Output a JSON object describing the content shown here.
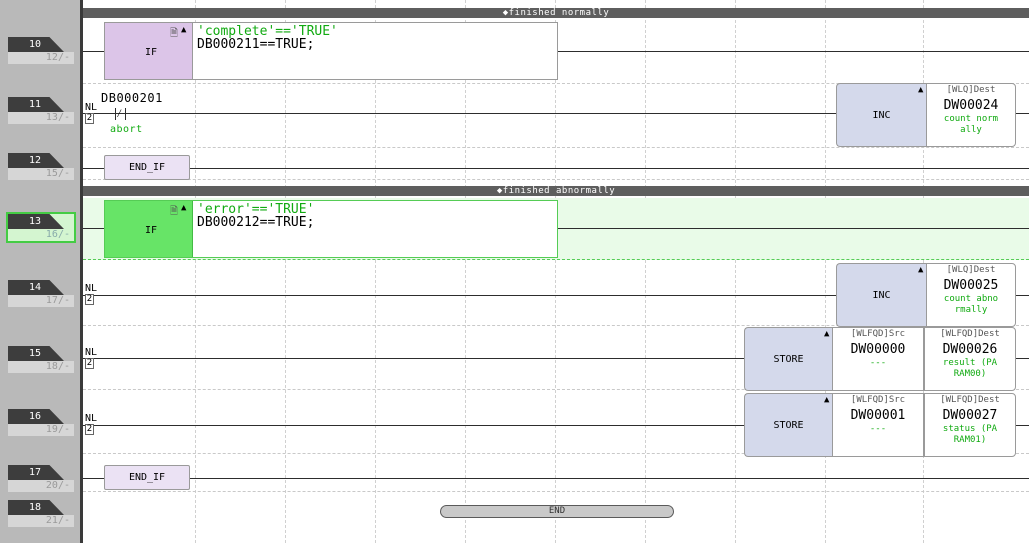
{
  "sections": {
    "normal_label": "◆finished normally",
    "abnormal_label": "◆finished abnormally"
  },
  "lines": [
    {
      "n": "10",
      "sub": "12/-"
    },
    {
      "n": "11",
      "sub": "13/-"
    },
    {
      "n": "12",
      "sub": "15/-"
    },
    {
      "n": "13",
      "sub": "16/-"
    },
    {
      "n": "14",
      "sub": "17/-"
    },
    {
      "n": "15",
      "sub": "18/-"
    },
    {
      "n": "16",
      "sub": "19/-"
    },
    {
      "n": "17",
      "sub": "20/-"
    },
    {
      "n": "18",
      "sub": "21/-"
    }
  ],
  "if1": {
    "keyword": "IF",
    "doc_icon": "document-icon",
    "expr1": "'complete'=='TRUE'",
    "expr2": "DB000211==TRUE;"
  },
  "rung11": {
    "nl": "NL",
    "nl_num": "2",
    "contact_addr": "DB000201",
    "contact_comment": "abort",
    "fb_name": "INC",
    "dest_header": "[WLQ]Dest",
    "dest_operand": "DW00024",
    "dest_comment": "count norm\nally"
  },
  "endif1": {
    "label": "END_IF"
  },
  "if2": {
    "keyword": "IF",
    "doc_icon": "document-icon",
    "expr1": "'error'=='TRUE'",
    "expr2": "DB000212==TRUE;"
  },
  "rung14": {
    "nl": "NL",
    "nl_num": "2",
    "fb_name": "INC",
    "dest_header": "[WLQ]Dest",
    "dest_operand": "DW00025",
    "dest_comment": "count abno\nrmally"
  },
  "rung15": {
    "nl": "NL",
    "nl_num": "2",
    "fb_name": "STORE",
    "src_header": "[WLFQD]Src",
    "src_operand": "DW00000",
    "src_comment": "---",
    "dest_header": "[WLFQD]Dest",
    "dest_operand": "DW00026",
    "dest_comment": "result (PA\nRAM00)"
  },
  "rung16": {
    "nl": "NL",
    "nl_num": "2",
    "fb_name": "STORE",
    "src_header": "[WLFQD]Src",
    "src_operand": "DW00001",
    "src_comment": "---",
    "dest_header": "[WLFQD]Dest",
    "dest_operand": "DW00027",
    "dest_comment": "status (PA\nRAM01)"
  },
  "endif2": {
    "label": "END_IF"
  },
  "end": {
    "label": "END"
  },
  "colors": {
    "active_green": "#67e467",
    "comment_green": "#11aa11",
    "if_block": "#dcc5e8",
    "fb_block": "#d4d9eb"
  }
}
